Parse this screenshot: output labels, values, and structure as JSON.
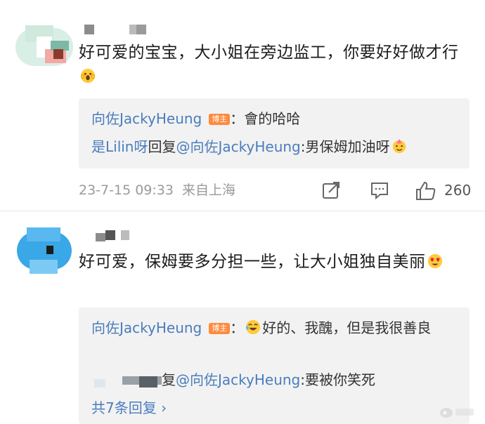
{
  "comments": [
    {
      "text": "好可爱的宝宝，大小姐在旁边监工，你要好好做才行",
      "emoji": "scream-emoji",
      "replies": [
        {
          "name": "向佐JackyHeung",
          "badge": "博主",
          "sep": "：",
          "content": "會的哈哈"
        },
        {
          "prefix": "是Lilin呀",
          "reply_word": "回复",
          "target": "@向佐JackyHeung",
          "sep": ":",
          "content": "男保姆加油呀",
          "emoji": "party-emoji"
        }
      ],
      "timestamp": "23-7-15 09:33",
      "location": "来自上海",
      "likes": "260"
    },
    {
      "text": "好可爱，保姆要多分担一些，让大小姐独自美丽",
      "emoji": "heart-eyes-emoji",
      "replies": [
        {
          "name": "向佐JackyHeung",
          "badge": "博主",
          "sep": "：",
          "content": "好的、我醜，但是我很善良",
          "emoji": "laugh-emoji"
        },
        {
          "reply_word": "复",
          "target": "@向佐JackyHeung",
          "sep": ":",
          "content": "要被你笑死"
        }
      ],
      "more_replies": "共7条回复 ›"
    }
  ],
  "colors": {
    "link": "#4a7dbd",
    "badge": "#ff8a3d",
    "reply_bg": "#f2f2f2",
    "meta": "#9a9a9a"
  }
}
